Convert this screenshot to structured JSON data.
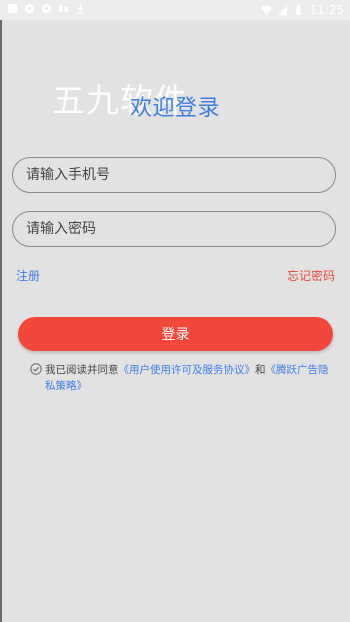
{
  "status_bar": {
    "time": "11:25",
    "icons": [
      "square-icon",
      "settings-circle-icon",
      "settings-circle-icon",
      "data-icon",
      "download-icon",
      "wifi-icon",
      "signal-icon",
      "battery-icon"
    ]
  },
  "watermark": "五九软件",
  "title": "欢迎登录",
  "phone_field": {
    "placeholder": "请输入手机号",
    "value": ""
  },
  "password_field": {
    "placeholder": "请输入密码",
    "value": ""
  },
  "register_link": "注册",
  "forgot_link": "忘记密码",
  "login_button": "登录",
  "agreement": {
    "prefix": "我已阅读并同意",
    "user_agreement": "《用户使用许可及服务协议》",
    "and": "和",
    "privacy_policy": "《腾跃广告隐私策略》"
  },
  "colors": {
    "accent_blue": "#3d7fe6",
    "primary_red": "#f2473a",
    "forgot_red": "#e84a3c",
    "background": "#e2e2e2"
  }
}
